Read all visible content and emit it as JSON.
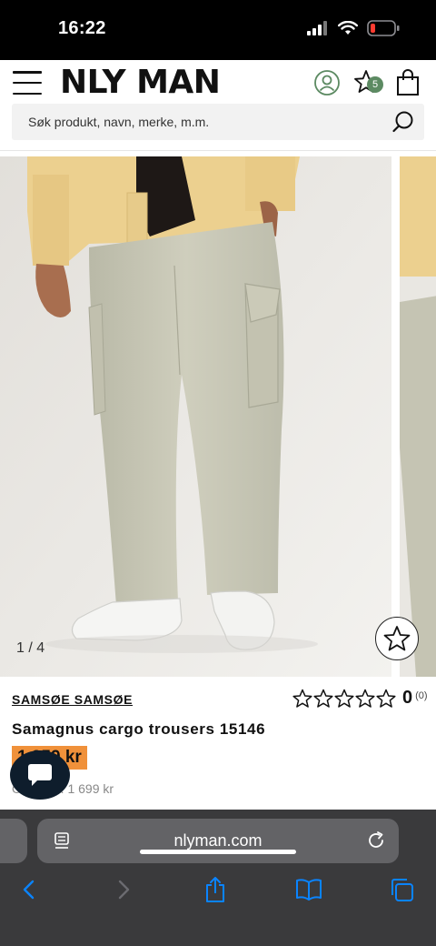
{
  "status_bar": {
    "time": "16:22"
  },
  "header": {
    "logo": "NLY MAN",
    "wishlist_count": "5",
    "search_placeholder": "Søk produkt, navn, merke, m.m."
  },
  "gallery": {
    "counter": "1 / 4"
  },
  "product": {
    "brand": "SAMSØE SAMSØE",
    "rating_value": "0",
    "rating_count": "(0)",
    "rating_stars": 0,
    "title": "Samagnus cargo trousers 15146",
    "price": "1 359 kr",
    "original_price": "Ord. pris: 1 699 kr"
  },
  "browser": {
    "url": "nlyman.com"
  },
  "colors": {
    "price_highlight": "#f0913a",
    "wishlist_badge": "#5c8a62",
    "chat_button": "#0e1d2c",
    "browser_toolbar": "#3a3a3c",
    "browser_accent": "#0a84ff"
  }
}
